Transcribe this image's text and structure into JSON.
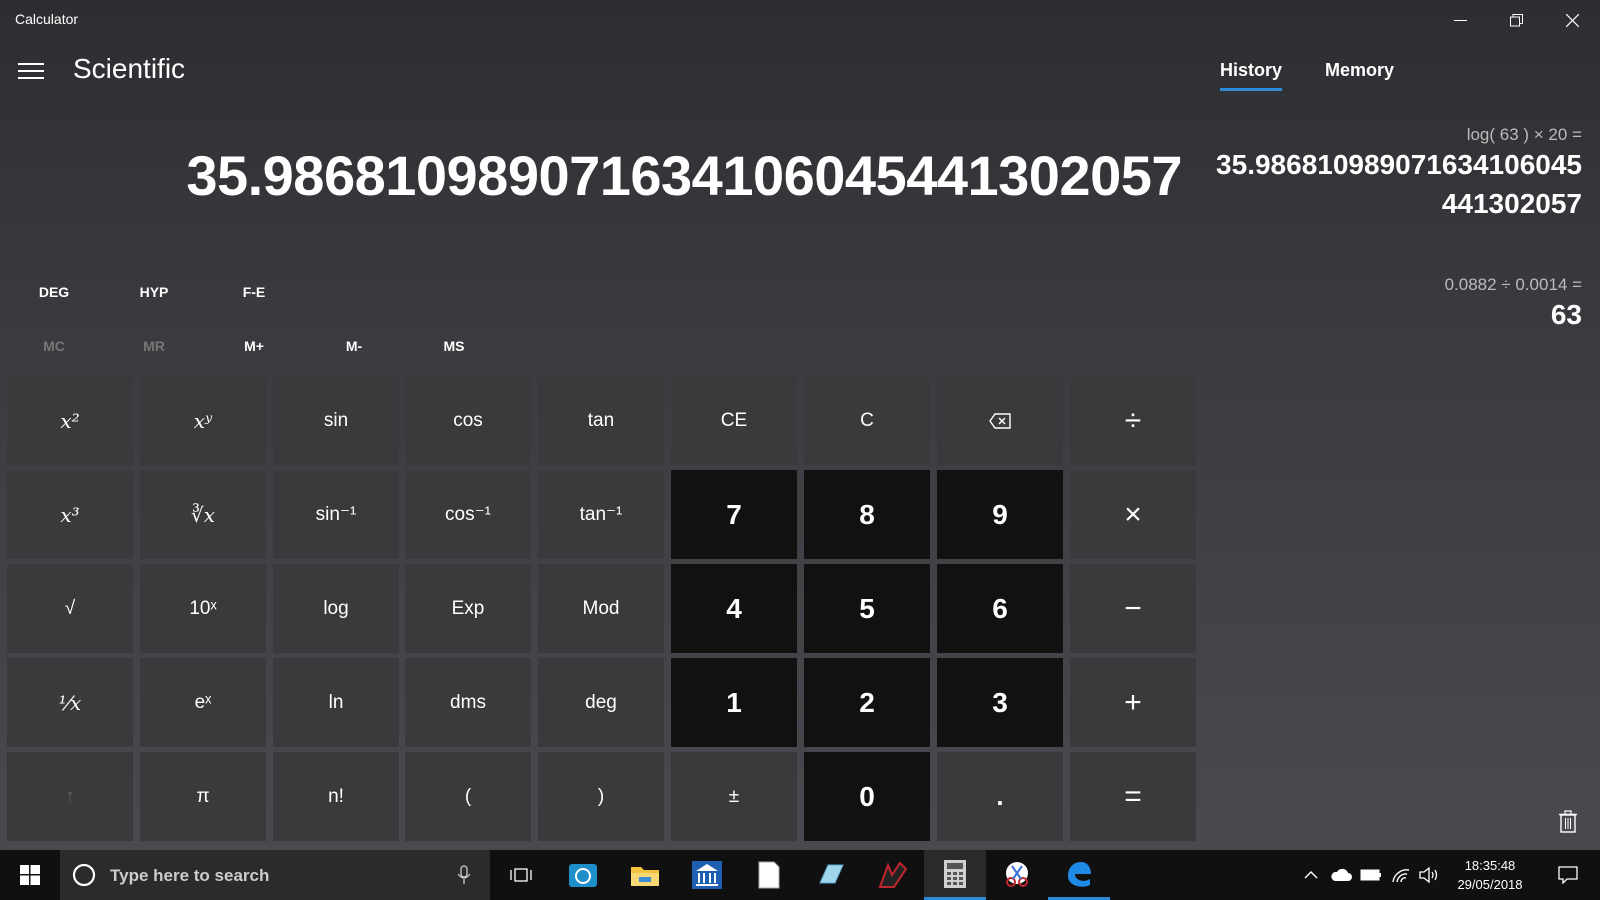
{
  "window": {
    "title": "Calculator"
  },
  "header": {
    "mode": "Scientific",
    "tabs": [
      "History",
      "Memory"
    ]
  },
  "display": {
    "value": "35.986810989071634106045441302057"
  },
  "modes": [
    "DEG",
    "HYP",
    "F-E"
  ],
  "memory_buttons": [
    "MC",
    "MR",
    "M+",
    "M-",
    "MS"
  ],
  "keys": {
    "r0": [
      "x²",
      "xʸ",
      "sin",
      "cos",
      "tan",
      "CE",
      "C",
      "⌫",
      "÷"
    ],
    "r1": [
      "x³",
      "∛x",
      "sin⁻¹",
      "cos⁻¹",
      "tan⁻¹",
      "7",
      "8",
      "9",
      "×"
    ],
    "r2": [
      "√",
      "10ˣ",
      "log",
      "Exp",
      "Mod",
      "4",
      "5",
      "6",
      "−"
    ],
    "r3": [
      "¹⁄x",
      "eˣ",
      "ln",
      "dms",
      "deg",
      "1",
      "2",
      "3",
      "+"
    ],
    "r4": [
      "↑",
      "π",
      "n!",
      "(",
      ")",
      "±",
      "0",
      ".",
      "="
    ]
  },
  "history": [
    {
      "expression": "log( 63 )   ×   20 =",
      "result_line1": "35.98681098907163410604 5",
      "result_line1_text": "35.9868109890716341060 45",
      "result": [
        "35.986810989071634106045",
        "441302057"
      ]
    },
    {
      "expression": "0.0882   ÷   0.0014 =",
      "result": [
        "63"
      ]
    }
  ],
  "taskbar": {
    "search_placeholder": "Type here to search",
    "time": "18:35:48",
    "date": "29/05/2018"
  },
  "colors": {
    "accent": "#2d8bd8",
    "key_bg": "#3a3a3c",
    "num_bg": "#111111",
    "taskbar": "#101010"
  }
}
